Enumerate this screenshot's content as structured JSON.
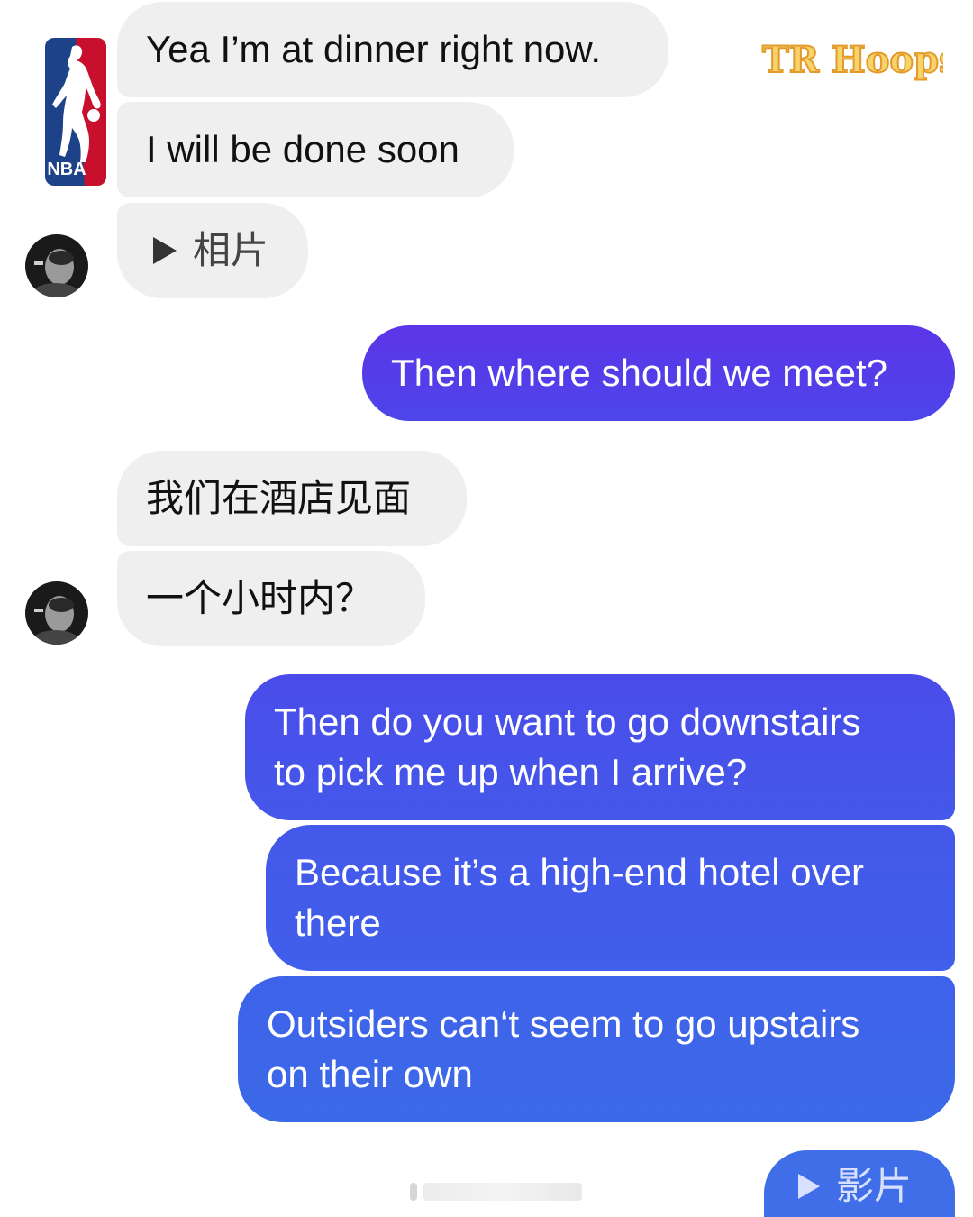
{
  "brand": {
    "logo_text": "NBA",
    "watermark_text": "TR Hoops",
    "colors": {
      "logo_blue": "#1d428a",
      "logo_red": "#c8102e",
      "watermark_fill": "#f6d36b",
      "watermark_outline": "#e39a2b"
    }
  },
  "colors": {
    "incoming_bubble": "#efefef",
    "outgoing_top": "#5c35e8",
    "outgoing_bottom": "#3b6ae8"
  },
  "messages": [
    {
      "sender": "them",
      "text": "Yea I’m at dinner right now."
    },
    {
      "sender": "them",
      "text": "I will be done soon"
    },
    {
      "sender": "them",
      "type": "media",
      "icon": "play-icon",
      "text": "相片"
    },
    {
      "sender": "me",
      "text": "Then where should we meet?"
    },
    {
      "sender": "them",
      "text": "我们在酒店见面"
    },
    {
      "sender": "them",
      "text": "一个小时内？"
    },
    {
      "sender": "me",
      "lines": [
        "Then do you want to go downstairs",
        "to pick me up when I arrive?"
      ]
    },
    {
      "sender": "me",
      "lines": [
        "Because it’s a high-end hotel over",
        "there"
      ]
    },
    {
      "sender": "me",
      "lines": [
        "Outsiders can‘t seem to go upstairs",
        "on their own"
      ]
    },
    {
      "sender": "me",
      "type": "media",
      "icon": "play-icon",
      "text": "影片"
    }
  ]
}
